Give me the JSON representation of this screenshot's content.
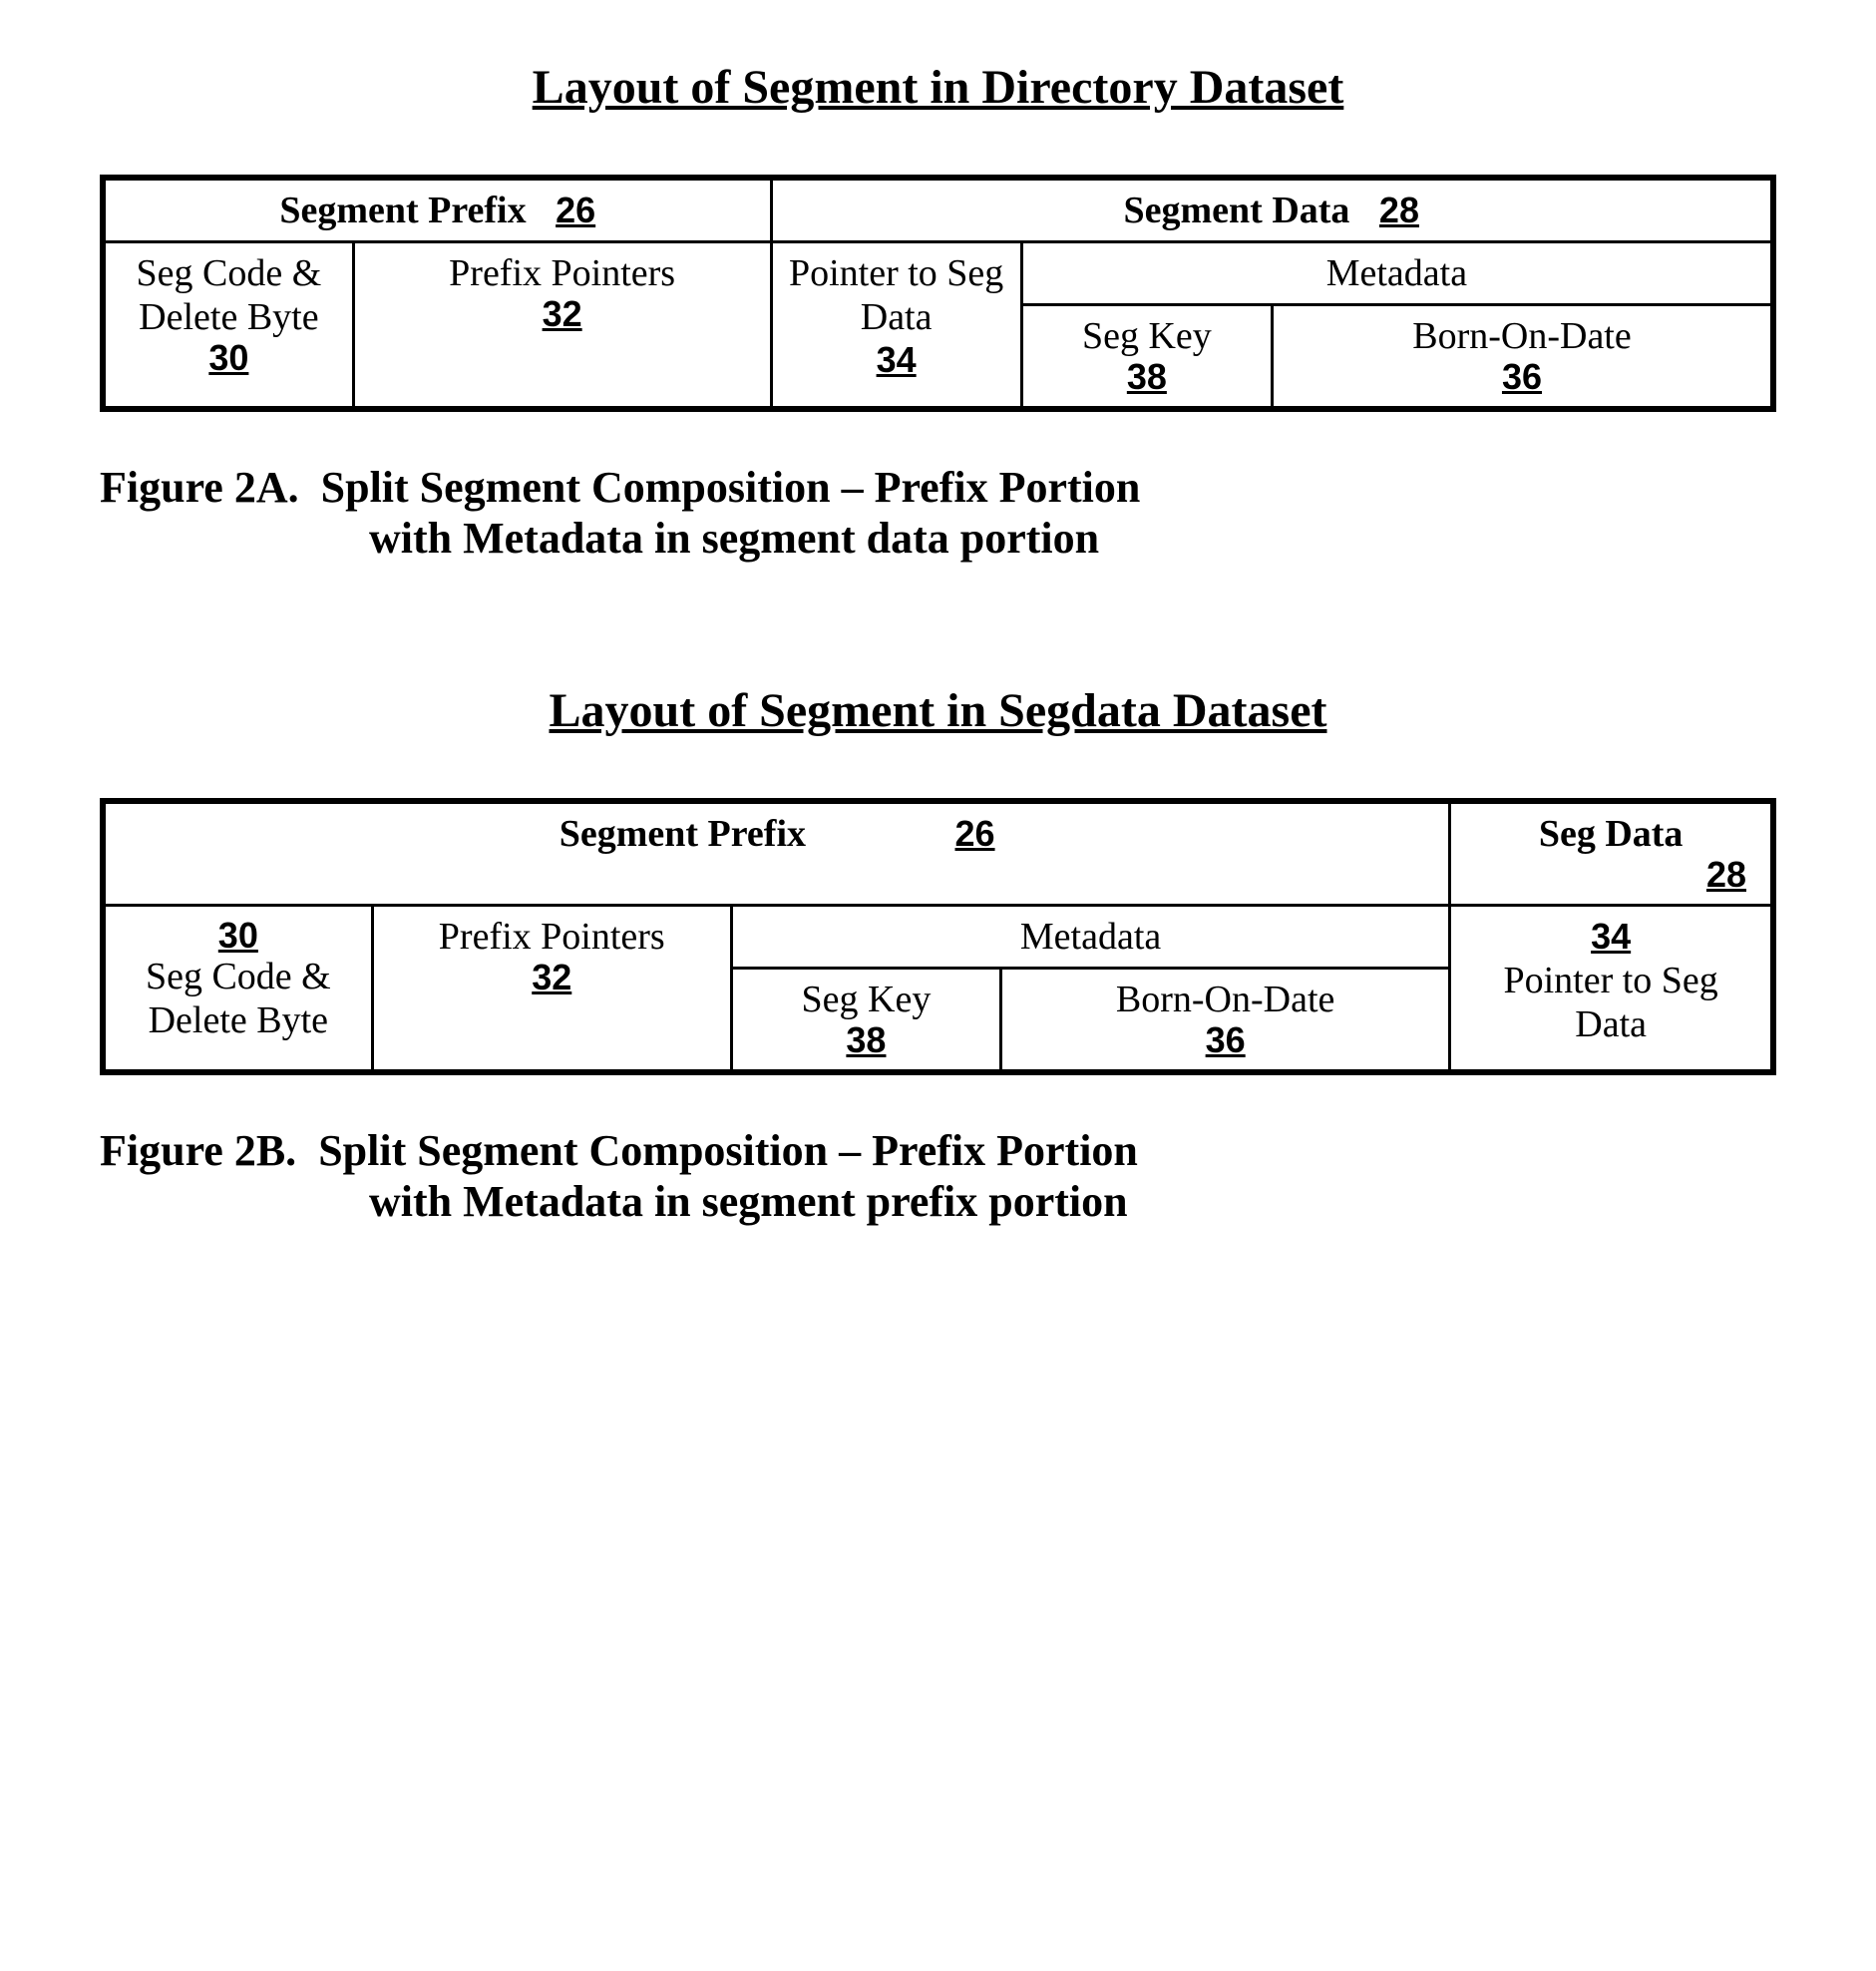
{
  "figA": {
    "title": "Layout of Segment in Directory Dataset",
    "prefix_header": "Segment Prefix",
    "prefix_ref": "26",
    "data_header": "Segment Data",
    "data_ref": "28",
    "seg_code": "Seg Code & Delete Byte",
    "seg_code_ref": "30",
    "prefix_pointers": "Prefix Pointers",
    "prefix_pointers_ref": "32",
    "pointer_to_seg_data": "Pointer to Seg Data",
    "pointer_ref": "34",
    "metadata": "Metadata",
    "seg_key": "Seg Key",
    "seg_key_ref": "38",
    "born_on_date": "Born-On-Date",
    "born_on_date_ref": "36",
    "caption_label": "Figure 2A.",
    "caption_line1": "Split Segment Composition – Prefix Portion",
    "caption_line2": "with Metadata in segment data portion"
  },
  "figB": {
    "title": "Layout of Segment in Segdata Dataset",
    "prefix_header": "Segment Prefix",
    "prefix_ref": "26",
    "data_header": "Seg Data",
    "data_ref": "28",
    "seg_code": "Seg Code & Delete Byte",
    "seg_code_ref": "30",
    "prefix_pointers": "Prefix Pointers",
    "prefix_pointers_ref": "32",
    "metadata": "Metadata",
    "seg_key": "Seg Key",
    "seg_key_ref": "38",
    "born_on_date": "Born-On-Date",
    "born_on_date_ref": "36",
    "pointer_to_seg_data": "Pointer to Seg Data",
    "pointer_ref": "34",
    "caption_label": "Figure 2B.",
    "caption_line1": "Split Segment Composition – Prefix Portion",
    "caption_line2": "with Metadata in segment prefix portion"
  }
}
